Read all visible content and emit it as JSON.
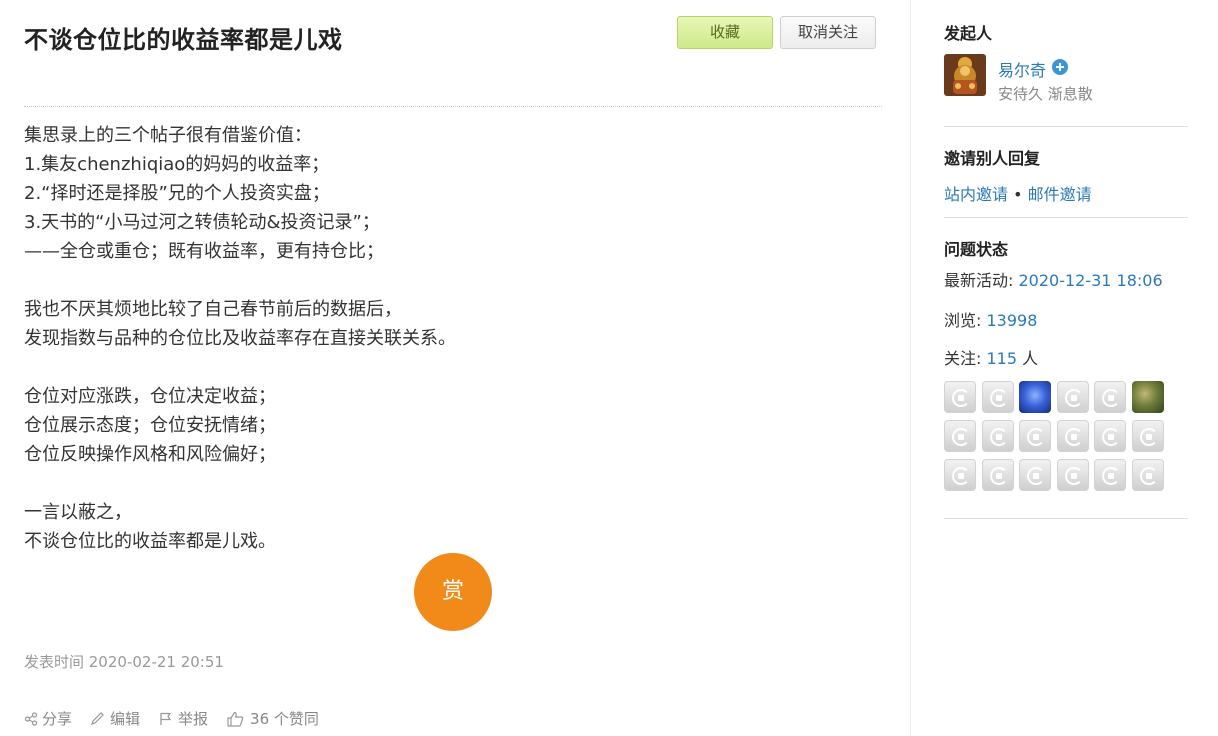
{
  "question": {
    "title": "不谈仓位比的收益率都是儿戏",
    "favorite_label": "收藏",
    "unfollow_label": "取消关注",
    "content_lines": [
      "集思录上的三个帖子很有借鉴价值：",
      "1.集友chenzhiqiao的妈妈的收益率；",
      "2.“择时还是择股”兄的个人投资实盘；",
      "3.天书的“小马过河之转债轮动&投资记录”；",
      "——全仓或重仓；既有收益率，更有持仓比；",
      "",
      "我也不厌其烦地比较了自己春节前后的数据后，",
      "发现指数与品种的仓位比及收益率存在直接关联关系。",
      "",
      "仓位对应涨跌，仓位决定收益；",
      "仓位展示态度；仓位安抚情绪；",
      "仓位反映操作风格和风险偏好；",
      "",
      "一言以蔽之，",
      "不谈仓位比的收益率都是儿戏。"
    ],
    "reward_label": "赏",
    "published": "发表时间 2020-02-21 20:51",
    "actions": {
      "share": "分享",
      "edit": "编辑",
      "report": "举报",
      "likes": "36 个赞同"
    }
  },
  "sidebar": {
    "author_heading": "发起人",
    "author_name": "易尔奇",
    "author_signature": "安待久 渐息散",
    "invite_heading": "邀请别人回复",
    "invite_site": "站内邀请",
    "invite_sep": "•",
    "invite_mail": "邮件邀请",
    "status_heading": "问题状态",
    "latest_label": "最新活动: ",
    "latest_value": "2020-12-31 18:06",
    "views_label": "浏览: ",
    "views_value": "13998",
    "followers_label": "关注: ",
    "followers_value": "115",
    "followers_unit": " 人",
    "follower_avatars": [
      "default",
      "default",
      "blue",
      "default",
      "default",
      "green",
      "default",
      "default",
      "default",
      "default",
      "default",
      "default",
      "default",
      "default",
      "default",
      "default",
      "default",
      "default"
    ]
  },
  "colors": {
    "link": "#2b79b8",
    "reward": "#f28a19",
    "favorite_btn": "#cde98a"
  }
}
